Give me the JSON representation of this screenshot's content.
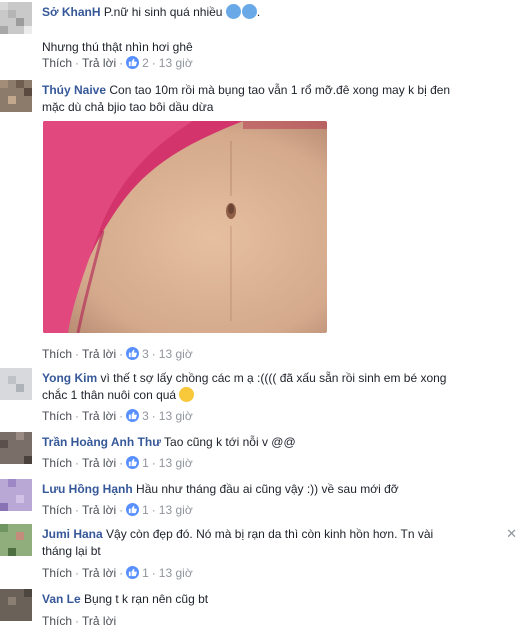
{
  "comments": [
    {
      "name": "Sở KhanH",
      "lines": [
        "P.nữ hi sinh quá nhiều",
        "Nhưng thú thật nhìn hơi ghê"
      ],
      "like": "Thích",
      "reply": "Trả lời",
      "likes": "2",
      "time": "13 giờ",
      "emoji": "cold-sweat-icon"
    },
    {
      "name": "Thúy Naive",
      "lines": [
        "Con tao 10m rồi mà bụng tao vẫn 1 rổ mỡ.đê xong may k bị đen",
        "mặc dù chả bjio tao bôi dầu dừa"
      ],
      "like": "Thích",
      "reply": "Trả lời",
      "likes": "3",
      "time": "13 giờ"
    },
    {
      "name": "Yong Kim",
      "lines": [
        "vì thế t sợ lấy chồng các m ạ :(((( đã xấu sẵn rồi sinh em bé xong",
        "chắc 1 thân nuôi con quá"
      ],
      "like": "Thích",
      "reply": "Trả lời",
      "likes": "3",
      "time": "13 giờ",
      "emoji": "confused-face-icon"
    },
    {
      "name": "Trần Hoàng Anh Thư",
      "lines": [
        "Tao cũng k tới nỗi v @@"
      ],
      "like": "Thích",
      "reply": "Trả lời",
      "likes": "1",
      "time": "13 giờ"
    },
    {
      "name": "Lưu Hồng Hạnh",
      "lines": [
        "Hầu như tháng đầu ai cũng vậy :)) về sau mới đỡ"
      ],
      "like": "Thích",
      "reply": "Trả lời",
      "likes": "1",
      "time": "13 giờ"
    },
    {
      "name": "Jumi Hana",
      "lines": [
        "Vậy còn đẹp đó. Nó mà bị rạn da thì còn kinh hồn hơn. Tn vài",
        "tháng lại bt"
      ],
      "like": "Thích",
      "reply": "Trả lời",
      "likes": "1",
      "time": "13 giờ"
    },
    {
      "name": "Van Le",
      "lines": [
        "Bụng t k rạn nên cũg bt"
      ],
      "like": "Thích",
      "reply": "Trả lời",
      "likes": "",
      "time": ""
    }
  ],
  "colors": {
    "name": "#365899",
    "text": "#1d2129",
    "meta": "#90949c",
    "like_badge": "#5890ff"
  }
}
